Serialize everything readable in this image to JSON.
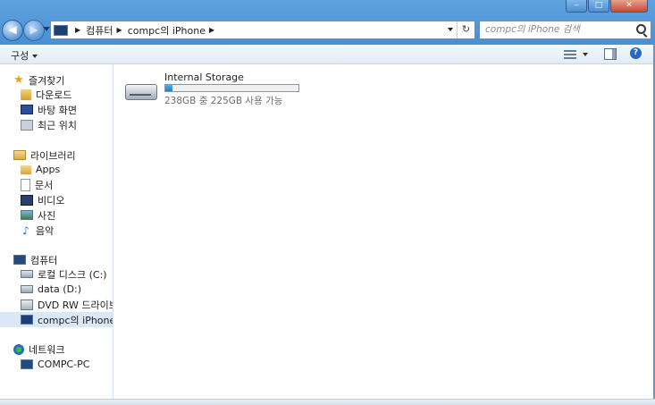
{
  "window": {
    "minimize_glyph": "‒",
    "maximize_glyph": "□",
    "close_glyph": "✕"
  },
  "nav": {
    "back_glyph": "◀",
    "forward_glyph": "▶"
  },
  "address": {
    "icon": "iphone-device-icon",
    "crumbs": [
      "컴퓨터",
      "compc의 iPhone"
    ],
    "refresh_glyph": "↻"
  },
  "search": {
    "placeholder": "compc의 iPhone 검색"
  },
  "toolbar": {
    "organize_label": "구성"
  },
  "sidebar": {
    "favorites": {
      "label": "즐겨찾기",
      "items": [
        {
          "label": "다운로드",
          "icon": "downloads-icon"
        },
        {
          "label": "바탕 화면",
          "icon": "desktop-icon"
        },
        {
          "label": "최근 위치",
          "icon": "recent-places-icon"
        }
      ]
    },
    "libraries": {
      "label": "라이브러리",
      "items": [
        {
          "label": "Apps",
          "icon": "folder-icon"
        },
        {
          "label": "문서",
          "icon": "documents-icon"
        },
        {
          "label": "비디오",
          "icon": "videos-icon"
        },
        {
          "label": "사진",
          "icon": "pictures-icon"
        },
        {
          "label": "음악",
          "icon": "music-icon"
        }
      ]
    },
    "computer": {
      "label": "컴퓨터",
      "items": [
        {
          "label": "로컬 디스크 (C:)",
          "icon": "local-disk-icon"
        },
        {
          "label": "data (D:)",
          "icon": "disk-icon"
        },
        {
          "label": "DVD RW 드라이브 (",
          "icon": "dvd-drive-icon"
        },
        {
          "label": "compc의 iPhone",
          "icon": "iphone-icon",
          "selected": true
        }
      ]
    },
    "network": {
      "label": "네트워크",
      "items": [
        {
          "label": "COMPC-PC",
          "icon": "network-pc-icon"
        }
      ]
    }
  },
  "content": {
    "storage": {
      "name": "Internal Storage",
      "free_text": "238GB 중 225GB 사용 가능",
      "used_fraction": 0.055
    }
  },
  "colors": {
    "title_band": "#4a8fd4",
    "selection": "#d9e7f7",
    "usage_bar": "#1a83c9"
  }
}
